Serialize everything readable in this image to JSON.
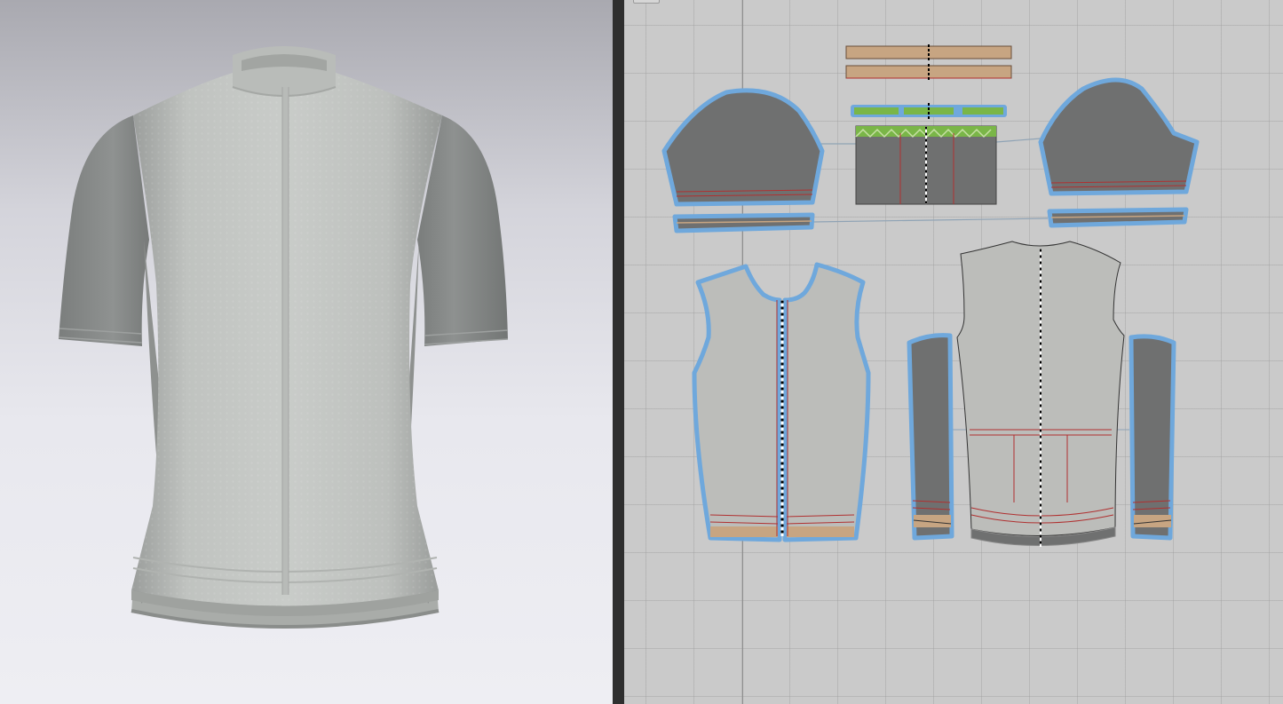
{
  "colors": {
    "jersey_body": "#c3c6c3",
    "jersey_sleeve": "#8c8f8e",
    "pattern_light": "#bcbdba",
    "pattern_dark": "#6f7070",
    "outline_blue": "#6fa8dc",
    "binding_tan": "#c7a582",
    "seam_red": "#b03030",
    "elastic_green": "#7ab648",
    "canvas_bg": "#cacaca"
  },
  "panels": {
    "left": "3d-garment-view",
    "right": "2d-pattern-view"
  }
}
